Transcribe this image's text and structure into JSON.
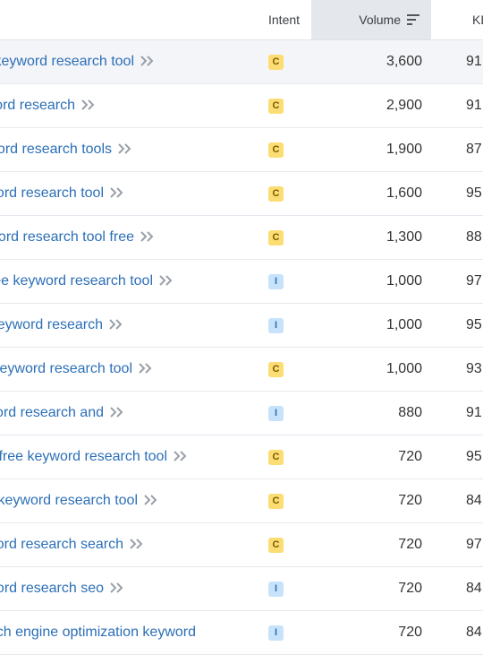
{
  "header": {
    "intent": "Intent",
    "volume": "Volume",
    "kd": "KD"
  },
  "rows": [
    {
      "keyword": "keyword research tool",
      "intent": "C",
      "volume": "3,600",
      "kd": "91"
    },
    {
      "keyword": "word research",
      "intent": "C",
      "volume": "2,900",
      "kd": "91"
    },
    {
      "keyword": "word research tools",
      "intent": "C",
      "volume": "1,900",
      "kd": "87"
    },
    {
      "keyword": "word research tool",
      "intent": "C",
      "volume": "1,600",
      "kd": "95"
    },
    {
      "keyword": "word research tool free",
      "intent": "C",
      "volume": "1,300",
      "kd": "88"
    },
    {
      "keyword": "free keyword research tool",
      "intent": "I",
      "volume": "1,000",
      "kd": "97"
    },
    {
      "keyword": "keyword research",
      "intent": "I",
      "volume": "1,000",
      "kd": "95"
    },
    {
      "keyword": "keyword research tool",
      "intent": "C",
      "volume": "1,000",
      "kd": "93"
    },
    {
      "keyword": "word research and",
      "intent": "I",
      "volume": "880",
      "kd": "91"
    },
    {
      "keyword": "free keyword research tool",
      "intent": "C",
      "volume": "720",
      "kd": "95"
    },
    {
      "keyword": "keyword research tool",
      "intent": "C",
      "volume": "720",
      "kd": "84"
    },
    {
      "keyword": "word research search",
      "intent": "C",
      "volume": "720",
      "kd": "97"
    },
    {
      "keyword": "word research seo",
      "intent": "I",
      "volume": "720",
      "kd": "84"
    },
    {
      "keyword": "search engine optimization keyword",
      "intent": "I",
      "volume": "720",
      "kd": "84"
    }
  ]
}
